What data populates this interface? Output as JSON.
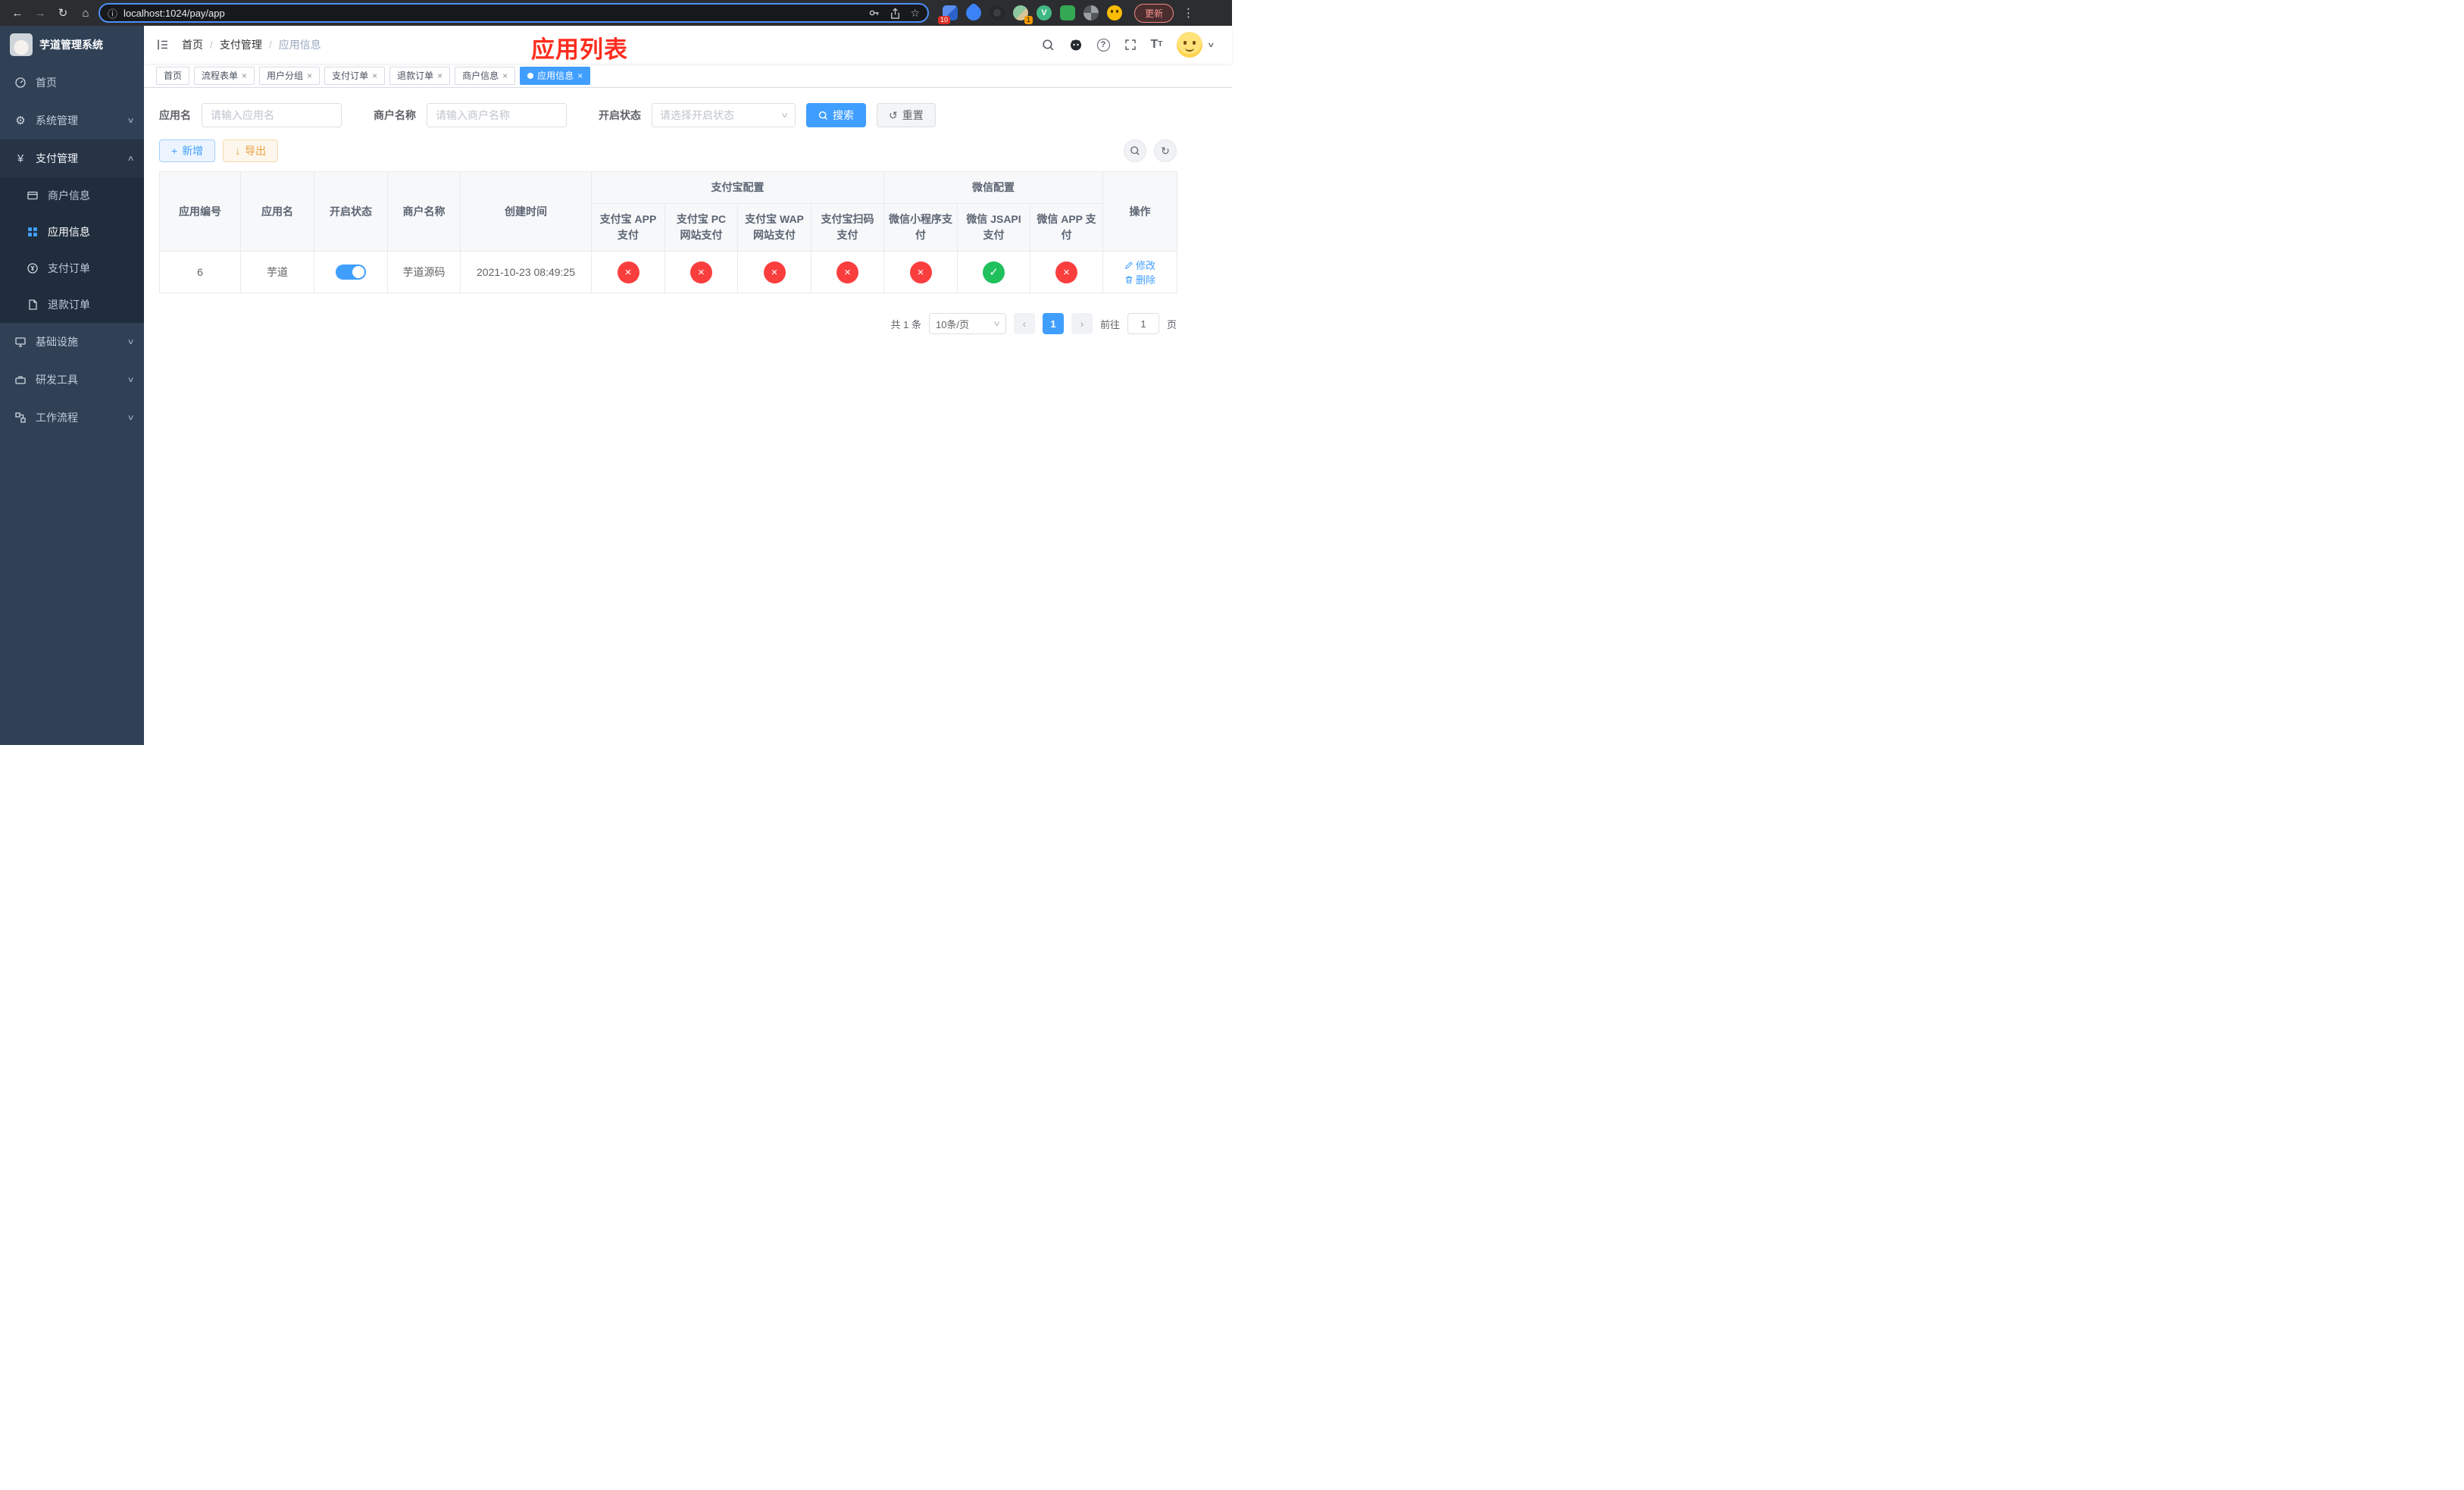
{
  "browser": {
    "url": "localhost:1024/pay/app",
    "update_label": "更新",
    "extension_badge_a": "10",
    "extension_badge_b": "1"
  },
  "icons": {
    "back": "←",
    "forward": "→",
    "reload": "↻",
    "home": "⌂",
    "info": "ⓘ",
    "star": "☆",
    "kebab": "⋮",
    "gear": "⚙",
    "yen": "¥",
    "chevron_down": "∨",
    "chevron_up": "∧",
    "caret_down": "▾",
    "select_arrow": "∨",
    "plus": "+",
    "download": "↓",
    "refresh": "↺",
    "reload2": "↻",
    "prev": "‹",
    "next": "›",
    "question": "?",
    "vue": "V",
    "tsize_big": "T",
    "tsize_small": "T"
  },
  "sidebar": {
    "logo_title": "芋道管理系统",
    "items": {
      "home": "首页",
      "system": "系统管理",
      "payment": "支付管理",
      "infra": "基础设施",
      "devtools": "研发工具",
      "workflow": "工作流程"
    },
    "payment_children": {
      "merchant": "商户信息",
      "app": "应用信息",
      "pay_order": "支付订单",
      "refund_order": "退款订单"
    }
  },
  "breadcrumb": {
    "home": "首页",
    "section": "支付管理",
    "current": "应用信息"
  },
  "overlay_title": "应用列表",
  "tabs": [
    {
      "label": "首页",
      "closable": false,
      "active": false
    },
    {
      "label": "流程表单",
      "closable": true,
      "active": false
    },
    {
      "label": "用户分组",
      "closable": true,
      "active": false
    },
    {
      "label": "支付订单",
      "closable": true,
      "active": false
    },
    {
      "label": "退款订单",
      "closable": true,
      "active": false
    },
    {
      "label": "商户信息",
      "closable": true,
      "active": false
    },
    {
      "label": "应用信息",
      "closable": true,
      "active": true
    }
  ],
  "close_glyph": "×",
  "filters": {
    "app_name_label": "应用名",
    "app_name_placeholder": "请输入应用名",
    "merchant_label": "商户名称",
    "merchant_placeholder": "请输入商户名称",
    "status_label": "开启状态",
    "status_placeholder": "请选择开启状态",
    "search_label": "搜索",
    "reset_label": "重置"
  },
  "toolbar": {
    "add_label": "新增",
    "export_label": "导出"
  },
  "table": {
    "headers": {
      "app_id": "应用编号",
      "app_name": "应用名",
      "status": "开启状态",
      "merchant": "商户名称",
      "created": "创建时间",
      "alipay_group": "支付宝配置",
      "wechat_group": "微信配置",
      "alipay_app": "支付宝 APP 支付",
      "alipay_pc": "支付宝 PC 网站支付",
      "alipay_wap": "支付宝 WAP 网站支付",
      "alipay_scan": "支付宝扫码支付",
      "wx_lite": "微信小程序支付",
      "wx_jsapi": "微信 JSAPI 支付",
      "wx_app": "微信 APP 支付",
      "actions": "操作"
    },
    "rows": [
      {
        "app_id": "6",
        "app_name": "芋道",
        "enabled": true,
        "merchant": "芋道源码",
        "created": "2021-10-23 08:49:25",
        "alipay_app": false,
        "alipay_pc": false,
        "alipay_wap": false,
        "alipay_scan": false,
        "wx_lite": false,
        "wx_jsapi": true,
        "wx_app": false,
        "edit_label": "修改",
        "delete_label": "删除"
      }
    ]
  },
  "pagination": {
    "total": "共 1 条",
    "page_size": "10条/页",
    "page": "1",
    "goto_prefix": "前往",
    "goto_value": "1",
    "goto_suffix": "页"
  },
  "colors": {
    "accent_blue": "#409eff",
    "success_green": "#20c05c",
    "danger_red": "#fa3e3e",
    "warning_yellow": "#e6a23c",
    "sidebar_bg": "#304156",
    "submenu_bg": "#1f2d3d",
    "annotation_red": "#fe2c1e",
    "tab_active_blue": "#409eff"
  }
}
